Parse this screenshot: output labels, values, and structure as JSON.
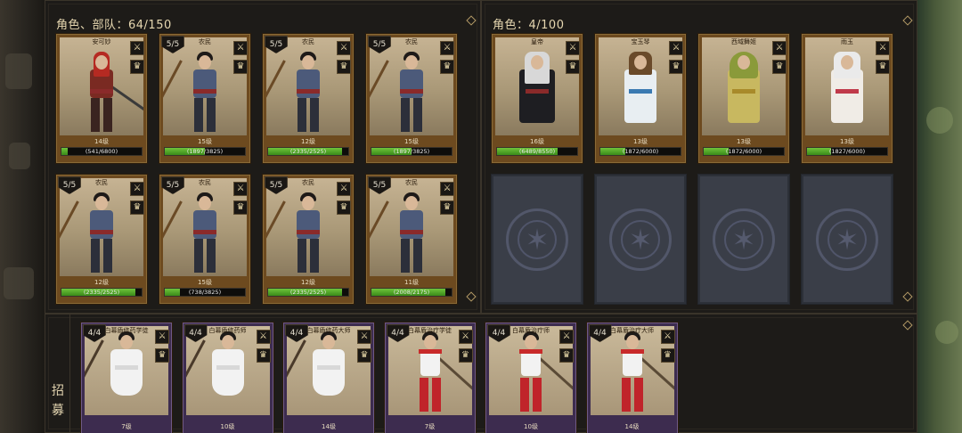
{
  "left_panel": {
    "title": "角色、部队：64/150",
    "cards": [
      {
        "name": "安可妙",
        "count": "",
        "level": "14级",
        "xp": "(541/6800)",
        "fill": 0.08,
        "fig": "warrior"
      },
      {
        "name": "农民",
        "count": "5/5",
        "level": "15级",
        "xp": "(1897/3825)",
        "fill": 0.5,
        "fig": "farmer"
      },
      {
        "name": "农民",
        "count": "5/5",
        "level": "12级",
        "xp": "(2335/2525)",
        "fill": 0.92,
        "fig": "farmer"
      },
      {
        "name": "农民",
        "count": "5/5",
        "level": "15级",
        "xp": "(1897/3825)",
        "fill": 0.5,
        "fig": "farmer"
      },
      {
        "name": "农民",
        "count": "5/5",
        "level": "12级",
        "xp": "(2335/2525)",
        "fill": 0.92,
        "fig": "farmer"
      },
      {
        "name": "农民",
        "count": "5/5",
        "level": "15级",
        "xp": "(738/3825)",
        "fill": 0.19,
        "fig": "farmer"
      },
      {
        "name": "农民",
        "count": "5/5",
        "level": "12级",
        "xp": "(2335/2525)",
        "fill": 0.92,
        "fig": "farmer"
      },
      {
        "name": "农民",
        "count": "5/5",
        "level": "11级",
        "xp": "(2008/2175)",
        "fill": 0.92,
        "fig": "farmer"
      }
    ]
  },
  "right_panel": {
    "title": "角色：4/100",
    "cards": [
      {
        "name": "皇帝",
        "level": "16级",
        "xp": "(6489/8550)",
        "fill": 0.76,
        "fig": "emperor"
      },
      {
        "name": "宝玉琴",
        "level": "13级",
        "xp": "(1872/6000)",
        "fill": 0.31,
        "fig": "lady1"
      },
      {
        "name": "西域舞姬",
        "level": "13级",
        "xp": "(1872/6000)",
        "fill": 0.31,
        "fig": "lady2"
      },
      {
        "name": "雨玉",
        "level": "13级",
        "xp": "(1827/6000)",
        "fill": 0.3,
        "fig": "lady3"
      }
    ],
    "empty_slots": 4
  },
  "recruit": {
    "label_1": "招",
    "label_2": "募",
    "cards": [
      {
        "name": "白幕盾修药学徒",
        "count": "4/4",
        "level": "7级",
        "fig": "robe"
      },
      {
        "name": "白幕盾修药师",
        "count": "4/4",
        "level": "10级",
        "fig": "robe"
      },
      {
        "name": "白幕盾修药大师",
        "count": "4/4",
        "level": "14级",
        "fig": "robe"
      },
      {
        "name": "白幕盾治疗学徒",
        "count": "4/4",
        "level": "7级",
        "fig": "redg"
      },
      {
        "name": "白幕盾治疗师",
        "count": "4/4",
        "level": "10级",
        "fig": "redg"
      },
      {
        "name": "白幕盾治疗大师",
        "count": "4/4",
        "level": "14级",
        "fig": "redg"
      }
    ]
  },
  "icons": {
    "weapon": "sword-icon",
    "role": "crown-icon"
  }
}
